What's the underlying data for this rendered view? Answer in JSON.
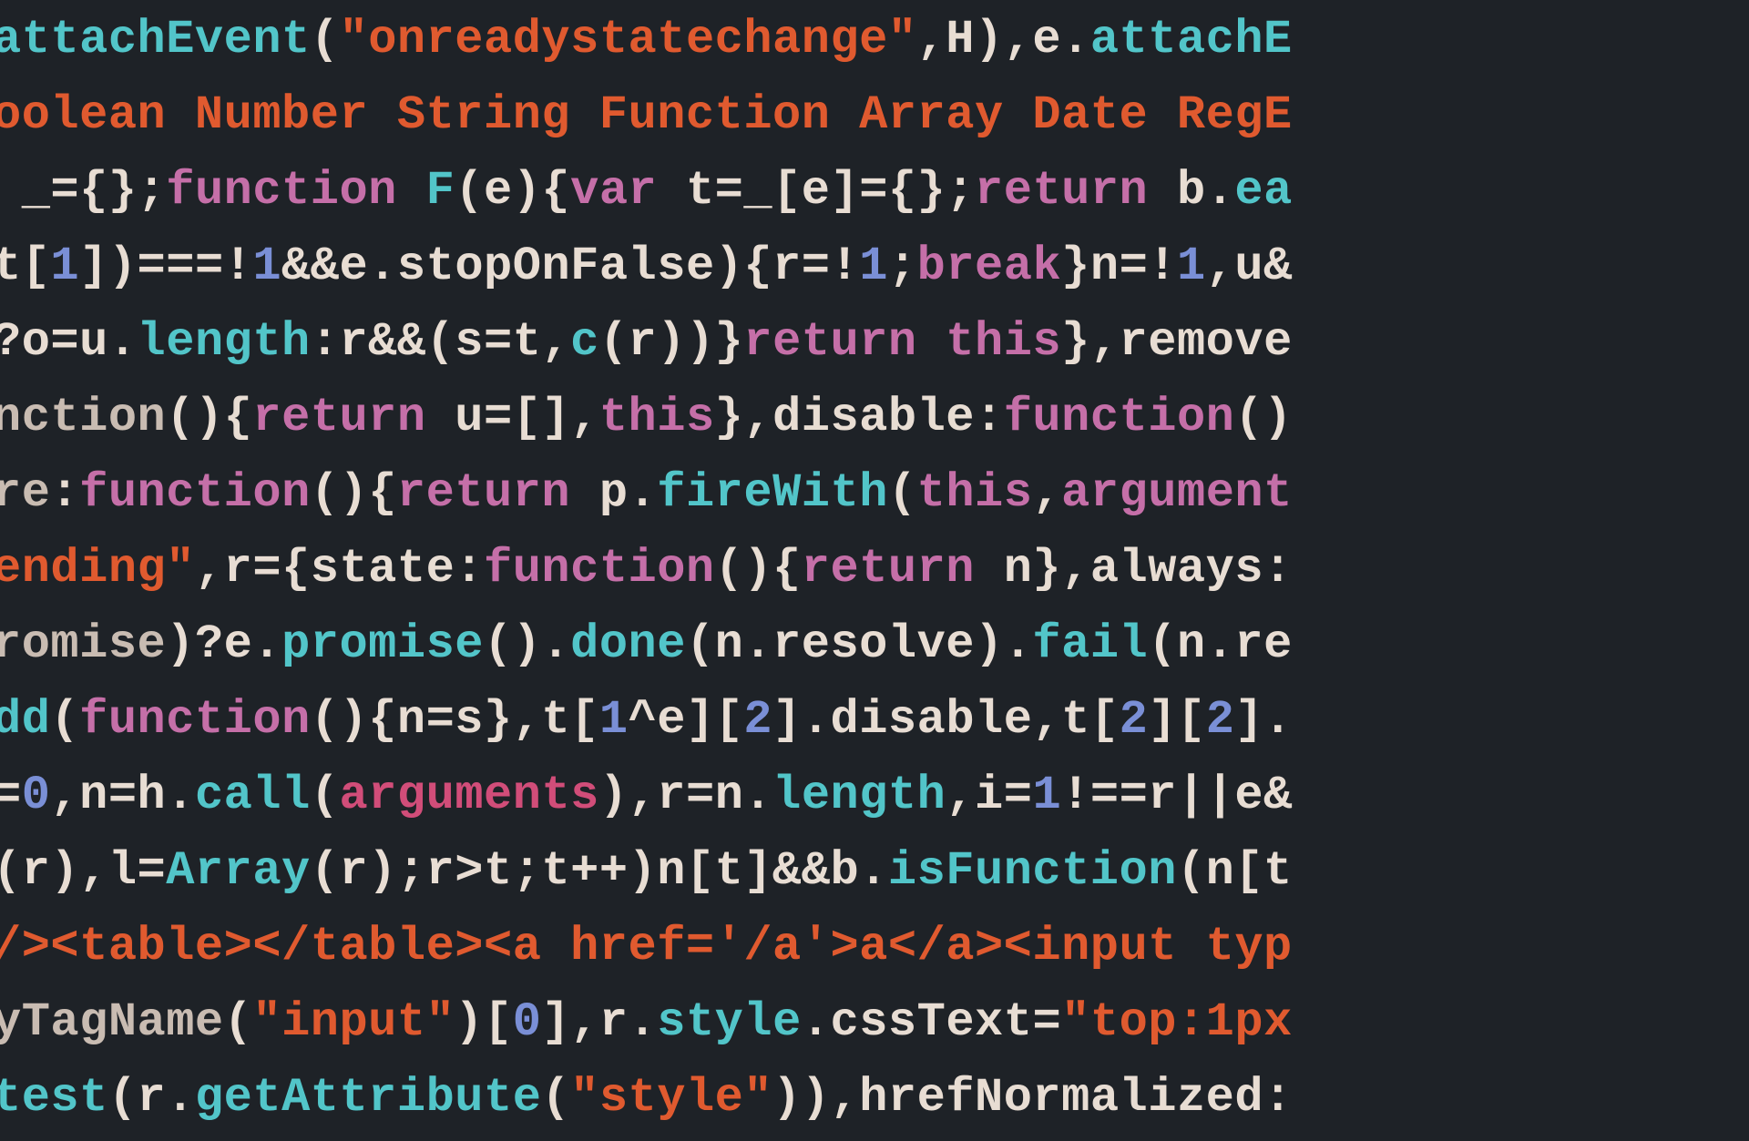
{
  "lines": [
    [
      {
        "cls": "t-fn",
        "txt": "attachEvent"
      },
      {
        "cls": "t-punc",
        "txt": "("
      },
      {
        "cls": "t-str",
        "txt": "\"onreadystatechange\""
      },
      {
        "cls": "t-punc",
        "txt": ",H),e."
      },
      {
        "cls": "t-fn",
        "txt": "attachE"
      }
    ],
    [
      {
        "cls": "t-str",
        "txt": "oolean Number String Function Array Date RegE"
      }
    ],
    [
      {
        "cls": "t-punc",
        "txt": " _={};"
      },
      {
        "cls": "t-kw",
        "txt": "function"
      },
      {
        "cls": "t-punc",
        "txt": " "
      },
      {
        "cls": "t-fn",
        "txt": "F"
      },
      {
        "cls": "t-punc",
        "txt": "(e){"
      },
      {
        "cls": "t-kw",
        "txt": "var"
      },
      {
        "cls": "t-punc",
        "txt": " t=_[e]={};"
      },
      {
        "cls": "t-kw",
        "txt": "return"
      },
      {
        "cls": "t-punc",
        "txt": " b."
      },
      {
        "cls": "t-fn",
        "txt": "ea"
      }
    ],
    [
      {
        "cls": "t-punc",
        "txt": "t["
      },
      {
        "cls": "t-num",
        "txt": "1"
      },
      {
        "cls": "t-punc",
        "txt": "])===!"
      },
      {
        "cls": "t-num",
        "txt": "1"
      },
      {
        "cls": "t-punc",
        "txt": "&&e.stopOnFalse){r=!"
      },
      {
        "cls": "t-num",
        "txt": "1"
      },
      {
        "cls": "t-punc",
        "txt": ";"
      },
      {
        "cls": "t-kw",
        "txt": "break"
      },
      {
        "cls": "t-punc",
        "txt": "}n=!"
      },
      {
        "cls": "t-num",
        "txt": "1"
      },
      {
        "cls": "t-punc",
        "txt": ",u&"
      }
    ],
    [
      {
        "cls": "t-punc",
        "txt": "?o=u."
      },
      {
        "cls": "t-fn",
        "txt": "length"
      },
      {
        "cls": "t-punc",
        "txt": ":r&&(s=t,"
      },
      {
        "cls": "t-fn",
        "txt": "c"
      },
      {
        "cls": "t-punc",
        "txt": "(r))}"
      },
      {
        "cls": "t-kw",
        "txt": "return this"
      },
      {
        "cls": "t-punc",
        "txt": "},remove"
      }
    ],
    [
      {
        "cls": "t-dim",
        "txt": "nction"
      },
      {
        "cls": "t-punc",
        "txt": "(){"
      },
      {
        "cls": "t-kw",
        "txt": "return"
      },
      {
        "cls": "t-punc",
        "txt": " u=[],"
      },
      {
        "cls": "t-kw",
        "txt": "this"
      },
      {
        "cls": "t-punc",
        "txt": "},disable:"
      },
      {
        "cls": "t-kw",
        "txt": "function"
      },
      {
        "cls": "t-punc",
        "txt": "()"
      }
    ],
    [
      {
        "cls": "t-dim",
        "txt": "re"
      },
      {
        "cls": "t-punc",
        "txt": ":"
      },
      {
        "cls": "t-kw",
        "txt": "function"
      },
      {
        "cls": "t-punc",
        "txt": "(){"
      },
      {
        "cls": "t-kw",
        "txt": "return"
      },
      {
        "cls": "t-punc",
        "txt": " p."
      },
      {
        "cls": "t-fn",
        "txt": "fireWith"
      },
      {
        "cls": "t-punc",
        "txt": "("
      },
      {
        "cls": "t-kw",
        "txt": "this"
      },
      {
        "cls": "t-punc",
        "txt": ","
      },
      {
        "cls": "t-kw",
        "txt": "argument"
      }
    ],
    [
      {
        "cls": "t-str",
        "txt": "ending\""
      },
      {
        "cls": "t-punc",
        "txt": ",r={state:"
      },
      {
        "cls": "t-kw",
        "txt": "function"
      },
      {
        "cls": "t-punc",
        "txt": "(){"
      },
      {
        "cls": "t-kw",
        "txt": "return"
      },
      {
        "cls": "t-punc",
        "txt": " n},always:"
      }
    ],
    [
      {
        "cls": "t-dim",
        "txt": "romise"
      },
      {
        "cls": "t-punc",
        "txt": ")?e."
      },
      {
        "cls": "t-fn",
        "txt": "promise"
      },
      {
        "cls": "t-punc",
        "txt": "()."
      },
      {
        "cls": "t-fn",
        "txt": "done"
      },
      {
        "cls": "t-punc",
        "txt": "(n.resolve)."
      },
      {
        "cls": "t-fn",
        "txt": "fail"
      },
      {
        "cls": "t-punc",
        "txt": "(n.re"
      }
    ],
    [
      {
        "cls": "t-fn",
        "txt": "dd"
      },
      {
        "cls": "t-punc",
        "txt": "("
      },
      {
        "cls": "t-kw",
        "txt": "function"
      },
      {
        "cls": "t-punc",
        "txt": "(){n=s},t["
      },
      {
        "cls": "t-num",
        "txt": "1"
      },
      {
        "cls": "t-punc",
        "txt": "^e]["
      },
      {
        "cls": "t-num",
        "txt": "2"
      },
      {
        "cls": "t-punc",
        "txt": "].disable,t["
      },
      {
        "cls": "t-num",
        "txt": "2"
      },
      {
        "cls": "t-punc",
        "txt": "]["
      },
      {
        "cls": "t-num",
        "txt": "2"
      },
      {
        "cls": "t-punc",
        "txt": "]."
      }
    ],
    [
      {
        "cls": "t-punc",
        "txt": "="
      },
      {
        "cls": "t-num",
        "txt": "0"
      },
      {
        "cls": "t-punc",
        "txt": ",n=h."
      },
      {
        "cls": "t-fn",
        "txt": "call"
      },
      {
        "cls": "t-punc",
        "txt": "("
      },
      {
        "cls": "t-arg",
        "txt": "arguments"
      },
      {
        "cls": "t-punc",
        "txt": "),r=n."
      },
      {
        "cls": "t-fn",
        "txt": "length"
      },
      {
        "cls": "t-punc",
        "txt": ",i="
      },
      {
        "cls": "t-num",
        "txt": "1"
      },
      {
        "cls": "t-punc",
        "txt": "!==r||e&"
      }
    ],
    [
      {
        "cls": "t-punc",
        "txt": "(r),l="
      },
      {
        "cls": "t-fn",
        "txt": "Array"
      },
      {
        "cls": "t-punc",
        "txt": "(r);r>t;t++)n[t]&&b."
      },
      {
        "cls": "t-fn",
        "txt": "isFunction"
      },
      {
        "cls": "t-punc",
        "txt": "(n[t"
      }
    ],
    [
      {
        "cls": "t-tag",
        "txt": "/><table></table><a href='/a'>a</a><input typ"
      }
    ],
    [
      {
        "cls": "t-dim",
        "txt": "yTagName"
      },
      {
        "cls": "t-punc",
        "txt": "("
      },
      {
        "cls": "t-str",
        "txt": "\"input\""
      },
      {
        "cls": "t-punc",
        "txt": ")["
      },
      {
        "cls": "t-num",
        "txt": "0"
      },
      {
        "cls": "t-punc",
        "txt": "],r."
      },
      {
        "cls": "t-fn",
        "txt": "style"
      },
      {
        "cls": "t-punc",
        "txt": ".cssText="
      },
      {
        "cls": "t-str",
        "txt": "\"top:1px"
      }
    ],
    [
      {
        "cls": "t-fn",
        "txt": "test"
      },
      {
        "cls": "t-punc",
        "txt": "(r."
      },
      {
        "cls": "t-fn",
        "txt": "getAttribute"
      },
      {
        "cls": "t-punc",
        "txt": "("
      },
      {
        "cls": "t-str",
        "txt": "\"style\""
      },
      {
        "cls": "t-punc",
        "txt": ")),hrefNormalized:"
      }
    ]
  ]
}
